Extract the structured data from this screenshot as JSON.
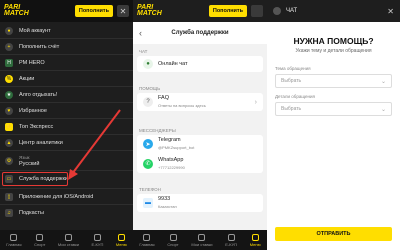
{
  "brand": {
    "logo_line1": "PARI",
    "logo_line2": "MATCH",
    "deposit_label": "Пополнить"
  },
  "menu": {
    "items": [
      {
        "label": "Мой аккаунт",
        "icon": "user-icon"
      },
      {
        "label": "Пополнить счёт",
        "icon": "wallet-icon"
      },
      {
        "label": "PM HERO",
        "icon": "hero-icon"
      },
      {
        "label": "Акции",
        "icon": "gift-icon"
      },
      {
        "label": "Алго отдыхать!",
        "icon": "star-icon"
      },
      {
        "label": "Избранное",
        "icon": "heart-icon"
      },
      {
        "label": "Топ Экспресс",
        "icon": "bolt-icon"
      },
      {
        "label": "Центр аналитики",
        "icon": "chart-icon"
      }
    ],
    "language": {
      "caption": "Язык",
      "value": "Русский"
    },
    "support_label": "Служба поддержки",
    "app_label": "Приложение для iOS/Android",
    "podcasts_label": "Подкасты"
  },
  "bottom_nav": [
    "Главная",
    "Спорт",
    "Мои ставки",
    "Е-КУП",
    "Меню"
  ],
  "support": {
    "title": "Служба поддержки",
    "chat_section": "ЧАТ",
    "online_chat": "Онлайн чат",
    "help_section": "ПОМОЩЬ",
    "faq": "FAQ",
    "faq_sub": "Ответы на вопросы здесь",
    "messengers_section": "МЕССЕНДЖЕРЫ",
    "telegram": "Telegram",
    "telegram_sub": "@PMKZsupport_bot",
    "whatsapp": "WhatsApp",
    "whatsapp_sub": "+77712229990",
    "phone_section": "ТЕЛЕФОН",
    "phone": "9933",
    "phone_sub": "Казахстан"
  },
  "chat_form": {
    "header": "ЧАТ",
    "title": "НУЖНА ПОМОЩЬ?",
    "subtitle": "Укажи тему и детали обращения",
    "topic_label": "Тема обращения",
    "topic_placeholder": "Выбрать",
    "details_label": "Детали обращения",
    "details_placeholder": "Выбрать",
    "send_label": "ОТПРАВИТЬ"
  },
  "colors": {
    "accent": "#ffde00",
    "dark": "#1e1e1e",
    "highlight": "#e53935"
  }
}
